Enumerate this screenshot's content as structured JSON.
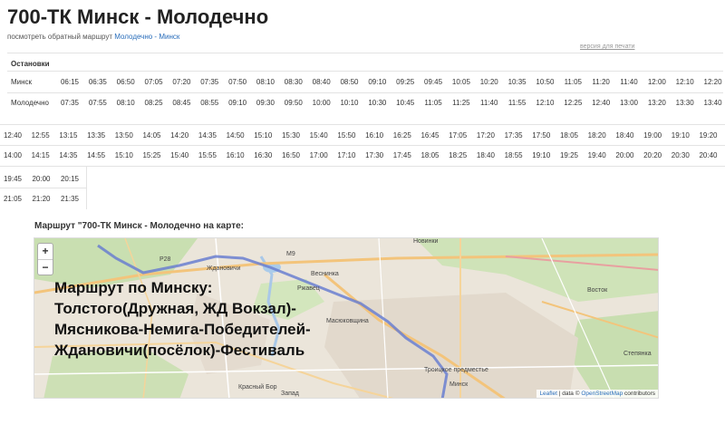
{
  "page": {
    "title": "700-ТК Минск - Молодечно",
    "reverse_prefix": "посмотреть обратный маршрут",
    "reverse_link": "Молодечно - Минск",
    "print_version": "версия для печати"
  },
  "table": {
    "header": "Остановки",
    "stops": [
      "Минск",
      "Молодечно"
    ],
    "row1_minsk": [
      "06:15",
      "06:35",
      "06:50",
      "07:05",
      "07:20",
      "07:35",
      "07:50",
      "08:10",
      "08:30",
      "08:40",
      "08:50",
      "09:10",
      "09:25",
      "09:45",
      "10:05",
      "10:20",
      "10:35",
      "10:50",
      "11:05",
      "11:20",
      "11:40",
      "12:00",
      "12:10",
      "12:20"
    ],
    "row1_molodechno": [
      "07:35",
      "07:55",
      "08:10",
      "08:25",
      "08:45",
      "08:55",
      "09:10",
      "09:30",
      "09:50",
      "10:00",
      "10:10",
      "10:30",
      "10:45",
      "11:05",
      "11:25",
      "11:40",
      "11:55",
      "12:10",
      "12:25",
      "12:40",
      "13:00",
      "13:20",
      "13:30",
      "13:40"
    ],
    "row2_minsk": [
      "12:40",
      "12:55",
      "13:15",
      "13:35",
      "13:50",
      "14:05",
      "14:20",
      "14:35",
      "14:50",
      "15:10",
      "15:30",
      "15:40",
      "15:50",
      "16:10",
      "16:25",
      "16:45",
      "17:05",
      "17:20",
      "17:35",
      "17:50",
      "18:05",
      "18:20",
      "18:40",
      "19:00",
      "19:10",
      "19:20"
    ],
    "row2_molodechno": [
      "14:00",
      "14:15",
      "14:35",
      "14:55",
      "15:10",
      "15:25",
      "15:40",
      "15:55",
      "16:10",
      "16:30",
      "16:50",
      "17:00",
      "17:10",
      "17:30",
      "17:45",
      "18:05",
      "18:25",
      "18:40",
      "18:55",
      "19:10",
      "19:25",
      "19:40",
      "20:00",
      "20:20",
      "20:30",
      "20:40"
    ],
    "row3_minsk": [
      "19:45",
      "20:00",
      "20:15"
    ],
    "row3_molodechno": [
      "21:05",
      "21:20",
      "21:35"
    ]
  },
  "map": {
    "title": "Маршрут \"700-ТК Минск - Молодечно на карте:",
    "zoom_in": "+",
    "zoom_out": "−",
    "overlay_lines": [
      "Маршрут по Минску:",
      "Толстого(Дружная, ЖД Вокзал)-",
      "Мясникова-Немига-Победителей-",
      "Ждановичи(посёлок)-Фестиваль"
    ],
    "places": [
      {
        "label": "Ждановичи"
      },
      {
        "label": "Ржавец"
      },
      {
        "label": "Веснинка"
      },
      {
        "label": "Масюковщина"
      },
      {
        "label": "Новинки"
      },
      {
        "label": "Восток"
      },
      {
        "label": "Степянка"
      },
      {
        "label": "Троицкое предместье"
      },
      {
        "label": "Минск"
      },
      {
        "label": "Красный Бор"
      },
      {
        "label": "Запад"
      },
      {
        "label": "М9"
      },
      {
        "label": "Р28"
      }
    ],
    "attribution": {
      "leaflet": "Leaflet",
      "sep": " | data © ",
      "osm": "OpenStreetMap",
      "suffix": " contributors"
    },
    "route_color": "#6a7fd0"
  }
}
